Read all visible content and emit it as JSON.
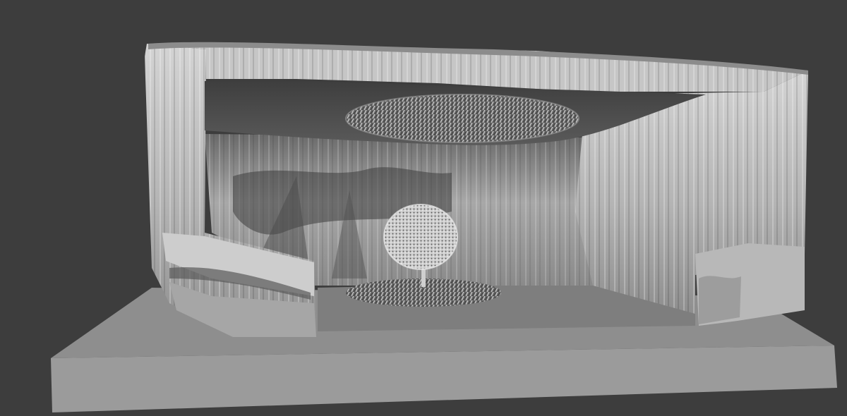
{
  "viewport": {
    "background_color": "#3d3d3d",
    "shading": "solid",
    "colors": {
      "base_top": "#8f8f8f",
      "base_front": "#9c9c9c",
      "inner_floor": "#7f7f7f",
      "wall": "#bcbcbc",
      "ceiling_shadow": "#4a4a4a",
      "foliage": "#e6e6e6"
    }
  },
  "scene_objects": [
    {
      "name": "base-slab",
      "icon": "cube-icon"
    },
    {
      "name": "cave-walls",
      "icon": "mesh-icon"
    },
    {
      "name": "ceiling-grass-clump",
      "icon": "particles-icon"
    },
    {
      "name": "tree",
      "icon": "tree-icon"
    },
    {
      "name": "ground-grass-patch",
      "icon": "particles-icon"
    }
  ]
}
